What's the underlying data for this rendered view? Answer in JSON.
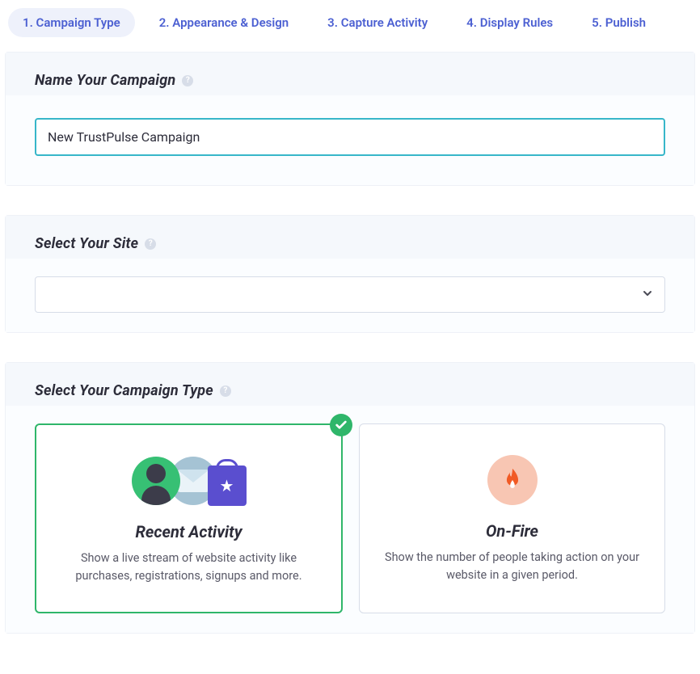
{
  "tabs": [
    {
      "label": "1. Campaign Type",
      "active": true
    },
    {
      "label": "2. Appearance & Design",
      "active": false
    },
    {
      "label": "3. Capture Activity",
      "active": false
    },
    {
      "label": "4. Display Rules",
      "active": false
    },
    {
      "label": "5. Publish",
      "active": false
    }
  ],
  "name_section": {
    "title": "Name Your Campaign",
    "value": "New TrustPulse Campaign"
  },
  "site_section": {
    "title": "Select Your Site",
    "value": ""
  },
  "type_section": {
    "title": "Select Your Campaign Type",
    "cards": [
      {
        "id": "recent-activity",
        "title": "Recent Activity",
        "description": "Show a live stream of website activity like purchases, registrations, signups and more.",
        "selected": true
      },
      {
        "id": "on-fire",
        "title": "On-Fire",
        "description": "Show the number of people taking action on your website in a given period.",
        "selected": false
      }
    ]
  }
}
